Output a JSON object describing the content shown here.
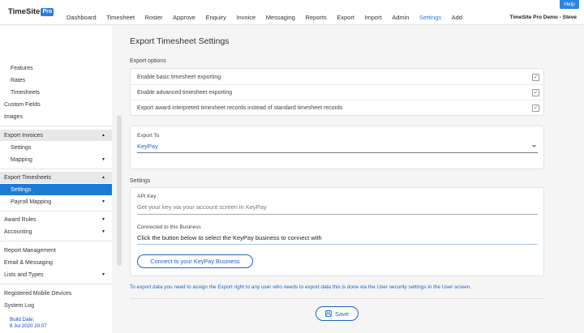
{
  "app": {
    "logo_text": "TimeSite",
    "logo_badge": "Pro",
    "help_label": "Help",
    "user_label": "TimeSite Pro Demo - Steve"
  },
  "nav": {
    "items": [
      "Dashboard",
      "Timesheet",
      "Roster",
      "Approve",
      "Enquiry",
      "Invoice",
      "Messaging",
      "Reports",
      "Export",
      "Import",
      "Admin",
      "Settings",
      "Add"
    ],
    "active": "Settings"
  },
  "sidebar": {
    "features": "Features",
    "rates": "Rates",
    "timesheets": "Timesheets",
    "custom_fields": "Custom Fields",
    "images": "Images",
    "export_invoices": "Export Invoices",
    "invoices_settings": "Settings",
    "invoices_mapping": "Mapping",
    "export_timesheets": "Export Timesheets",
    "timesheets_settings": "Settings",
    "payroll_mapping": "Payroll Mapping",
    "award_rules": "Award Rules",
    "accounting": "Accounting",
    "report_management": "Report Management",
    "email_messaging": "Email & Messaging",
    "lists_types": "Lists and Types",
    "registered_devices": "Registered Mobile Devices",
    "system_log": "System Log",
    "build_label": "Build Date:",
    "build_date": "8 Jul 2020 20:07"
  },
  "main": {
    "title": "Export Timesheet Settings",
    "export_options_label": "Export options",
    "options": [
      {
        "label": "Enable basic timesheet exporting",
        "checked": true
      },
      {
        "label": "Enable advanced timesheet exporting",
        "checked": true
      },
      {
        "label": "Export award interpreted timesheet records instead of standard timesheet records",
        "checked": true
      }
    ],
    "export_to_label": "Export To",
    "export_to_value": "KeyPay",
    "settings_label": "Settings",
    "api_key_label": "API Key",
    "api_key_placeholder": "Get your key via your account screen in KeyPay",
    "connected_label": "Connected to this Business",
    "connected_value": "Click the button below to select the KeyPay business to connect with",
    "connect_button": "Connect to your KeyPay Business",
    "info_text": "To export data you need to assign the Export right to any user who needs to export data this is done via the User security settings in the User screen.",
    "save_button": "Save"
  },
  "colors": {
    "accent": "#1e64c8",
    "selected_bg": "#1b7bd6"
  }
}
